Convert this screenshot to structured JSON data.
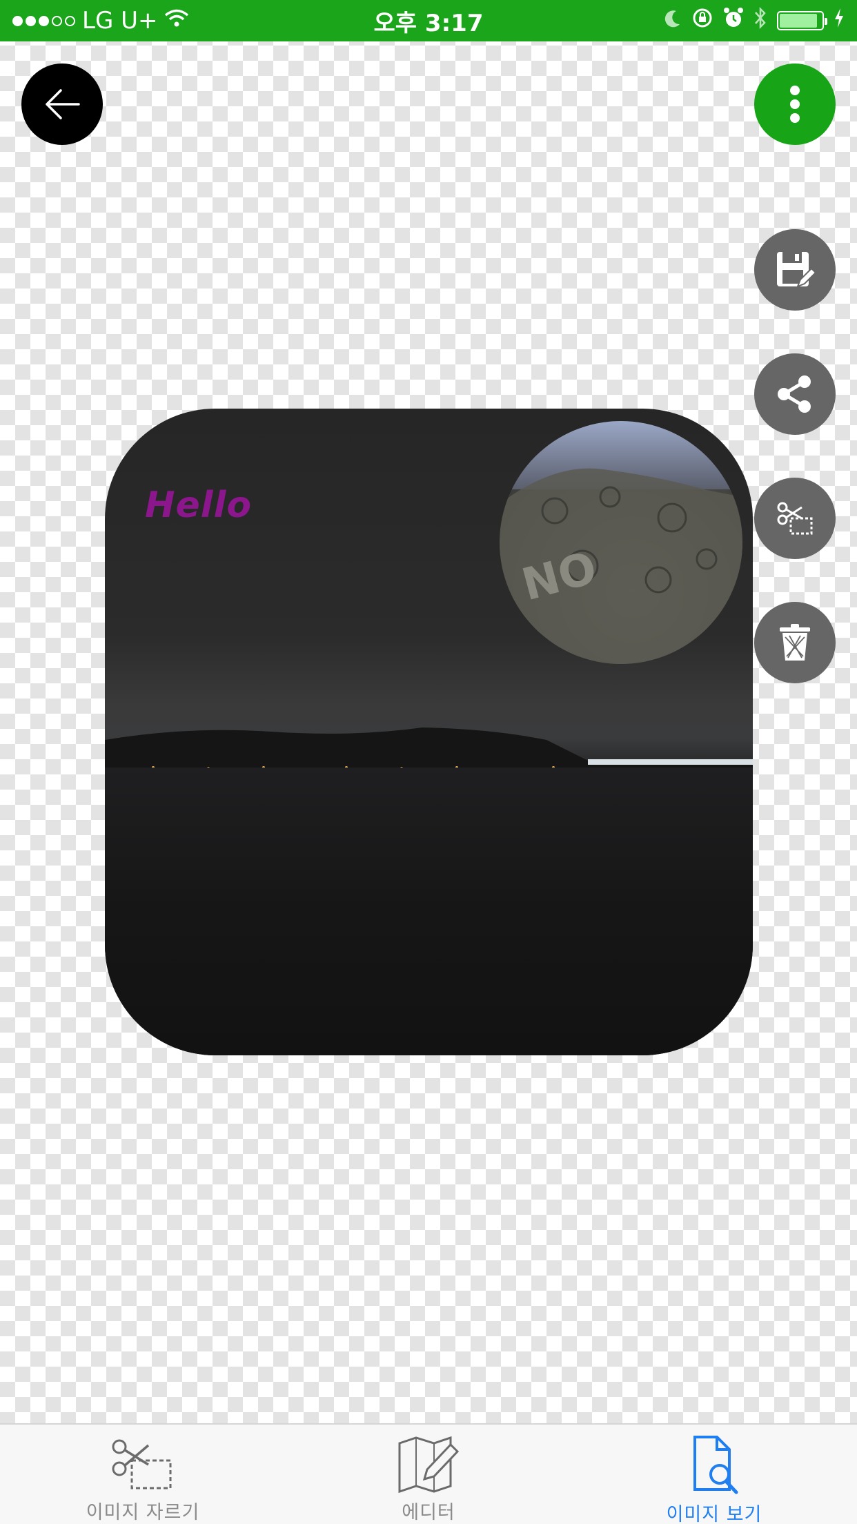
{
  "status_bar": {
    "carrier": "LG U+",
    "time": "오후 3:17",
    "signal_bars_filled": 3,
    "signal_bars_total": 5,
    "battery_level": 0.9
  },
  "top_actions": {
    "back_icon": "arrow-left-icon",
    "more_icon": "more-vertical-icon"
  },
  "side_tools": [
    {
      "name": "save",
      "icon": "save-edit-icon"
    },
    {
      "name": "share",
      "icon": "share-icon"
    },
    {
      "name": "cut",
      "icon": "scissors-crop-icon"
    },
    {
      "name": "delete",
      "icon": "trash-icon"
    }
  ],
  "canvas": {
    "text_layer": "Hello",
    "text_color": "#8c168c"
  },
  "tab_bar": {
    "tabs": [
      {
        "label": "이미지 자르기",
        "icon": "scissors-crop-icon",
        "active": false
      },
      {
        "label": "에디터",
        "icon": "map-pencil-icon",
        "active": false
      },
      {
        "label": "이미지 보기",
        "icon": "document-search-icon",
        "active": true
      }
    ]
  },
  "colors": {
    "status_bar": "#1aa51a",
    "more_button": "#17a517",
    "tool_button": "#666666",
    "active_tab": "#1f7ef0",
    "inactive_tab": "#8a8a8a"
  }
}
